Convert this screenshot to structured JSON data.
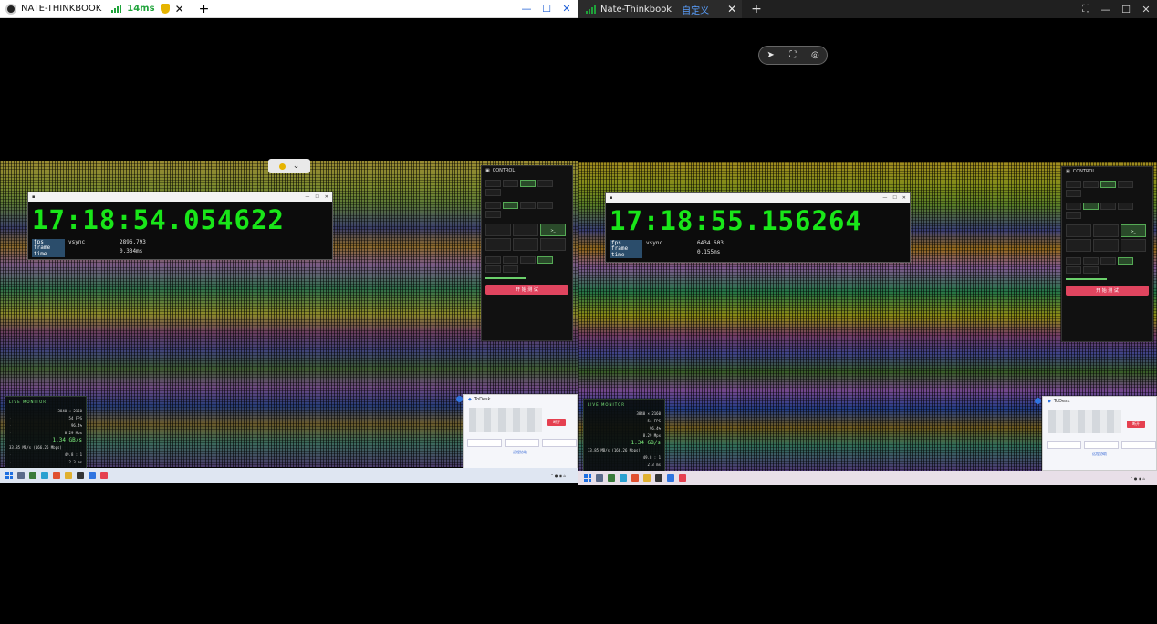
{
  "left": {
    "tab_title": "NATE-THINKBOOK",
    "latency": "14ms",
    "timer": "17:18:54.054622",
    "fps_label": "fps",
    "vsync_label": "vsync",
    "fps_value": "2896.793",
    "frame_time_label": "frame time",
    "frame_time_value": "0.334ms"
  },
  "right": {
    "tab_title": "Nate-Thinkbook",
    "custom_label": "自定义",
    "timer": "17:18:55.156264",
    "fps_label": "fps",
    "vsync_label": "vsync",
    "fps_value": "6434.603",
    "frame_time_label": "frame time",
    "frame_time_value": "0.155ms"
  },
  "control": {
    "title": "CONTROL",
    "start_label": "开 始 测 试"
  },
  "monitor": {
    "title": "LIVE MONITOR",
    "resolution": "3840 × 2160",
    "fps": "54 FPS",
    "percent": "96.4%",
    "rate": "8.29 Mpx",
    "throughput": "1.34 GB/s",
    "bandwidth": "33.85 MB/s (166.26 Mbps)",
    "ratio": "49.8 : 1",
    "last": "2.3 ms"
  },
  "todesk": {
    "title": "ToDesk",
    "red_btn": "断开",
    "link": "远程协助"
  },
  "colors": {
    "timer_green": "#19e619",
    "accent_red": "#e0455f",
    "latency_green": "#1fa33a"
  }
}
